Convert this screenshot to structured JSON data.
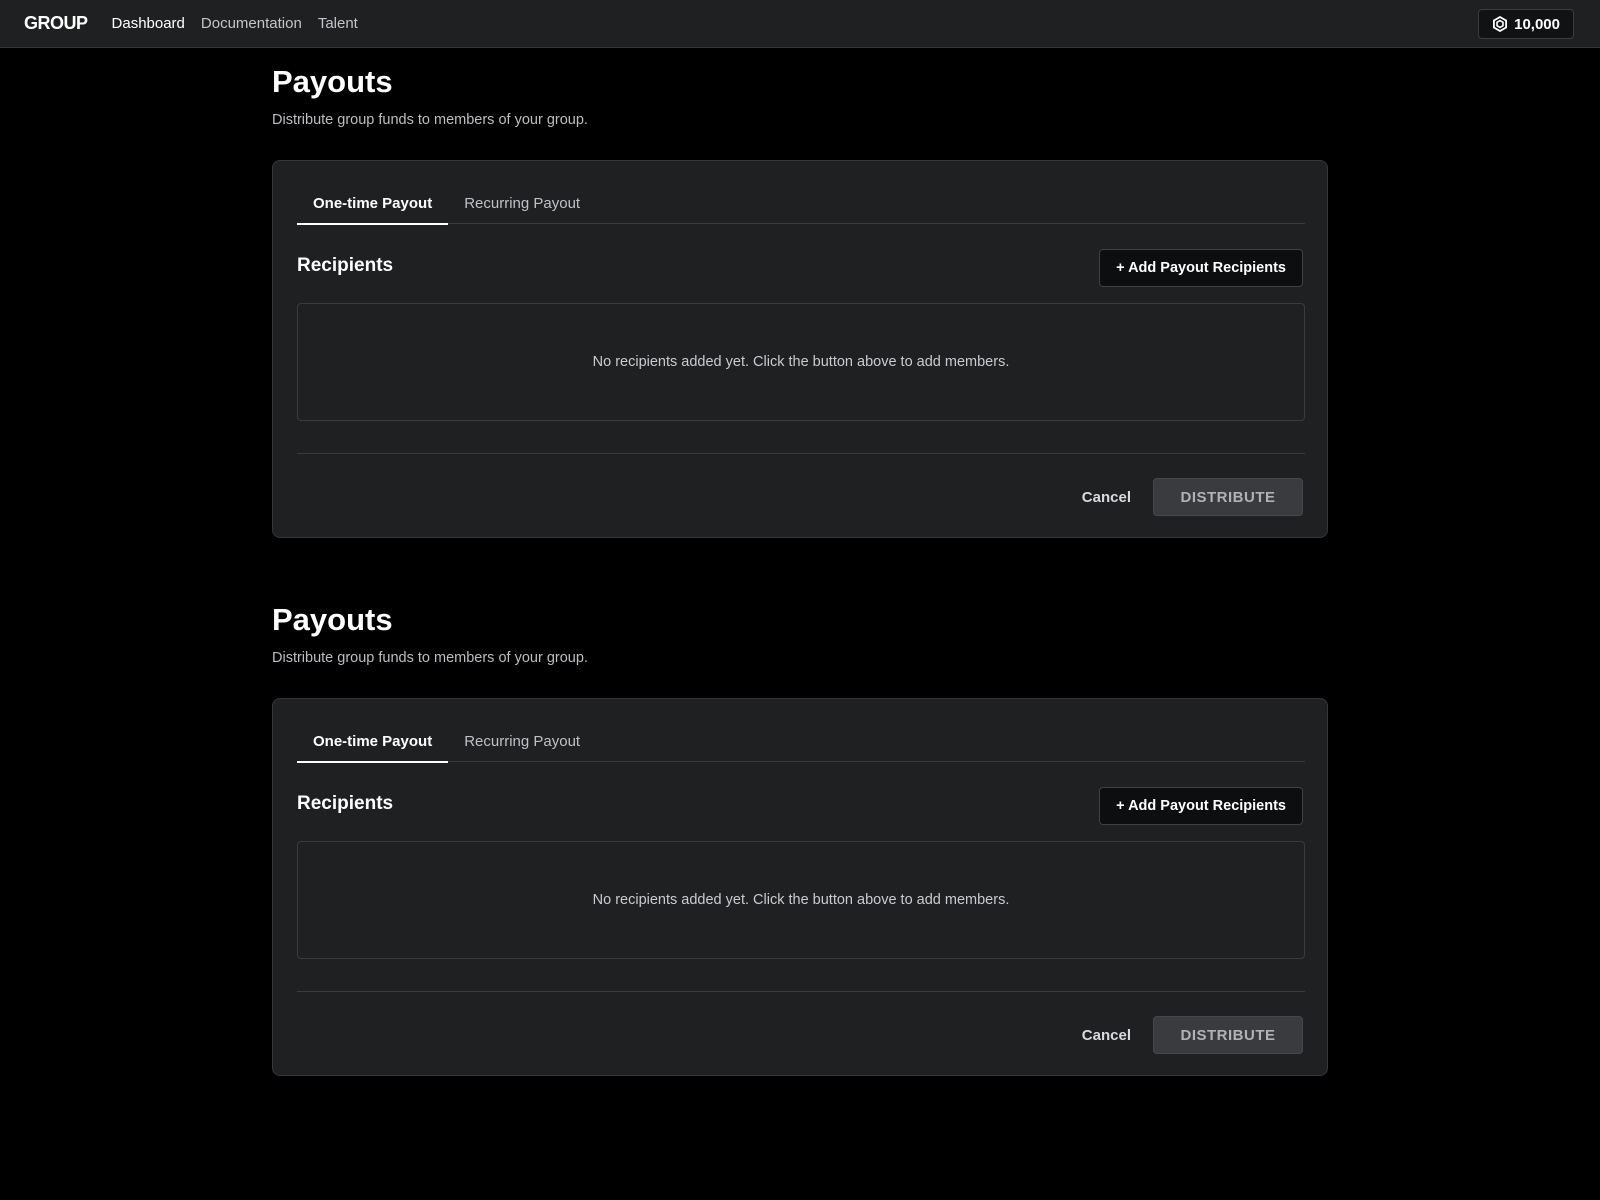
{
  "header": {
    "logo": "GROUP",
    "nav": [
      {
        "label": "Dashboard",
        "active": true
      },
      {
        "label": "Documentation",
        "active": false
      },
      {
        "label": "Talent",
        "active": false
      }
    ],
    "balance": "10,000",
    "balance_icon": "robux-coin-icon"
  },
  "sections": [
    {
      "title": "Payouts",
      "description": "Distribute group funds to members of your group.",
      "tabs": [
        {
          "label": "One-time Payout",
          "active": true
        },
        {
          "label": "Recurring Payout",
          "active": false
        }
      ],
      "recipients_title": "Recipients",
      "add_button": "+ Add Payout Recipients",
      "empty_message": "No recipients added yet. Click the button above to add members.",
      "cancel_label": "Cancel",
      "distribute_label": "DISTRIBUTE"
    },
    {
      "title": "Payouts",
      "description": "Distribute group funds to members of your group.",
      "tabs": [
        {
          "label": "One-time Payout",
          "active": true
        },
        {
          "label": "Recurring Payout",
          "active": false
        }
      ],
      "recipients_title": "Recipients",
      "add_button": "+ Add Payout Recipients",
      "empty_message": "No recipients added yet. Click the button above to add members.",
      "cancel_label": "Cancel",
      "distribute_label": "DISTRIBUTE"
    }
  ]
}
